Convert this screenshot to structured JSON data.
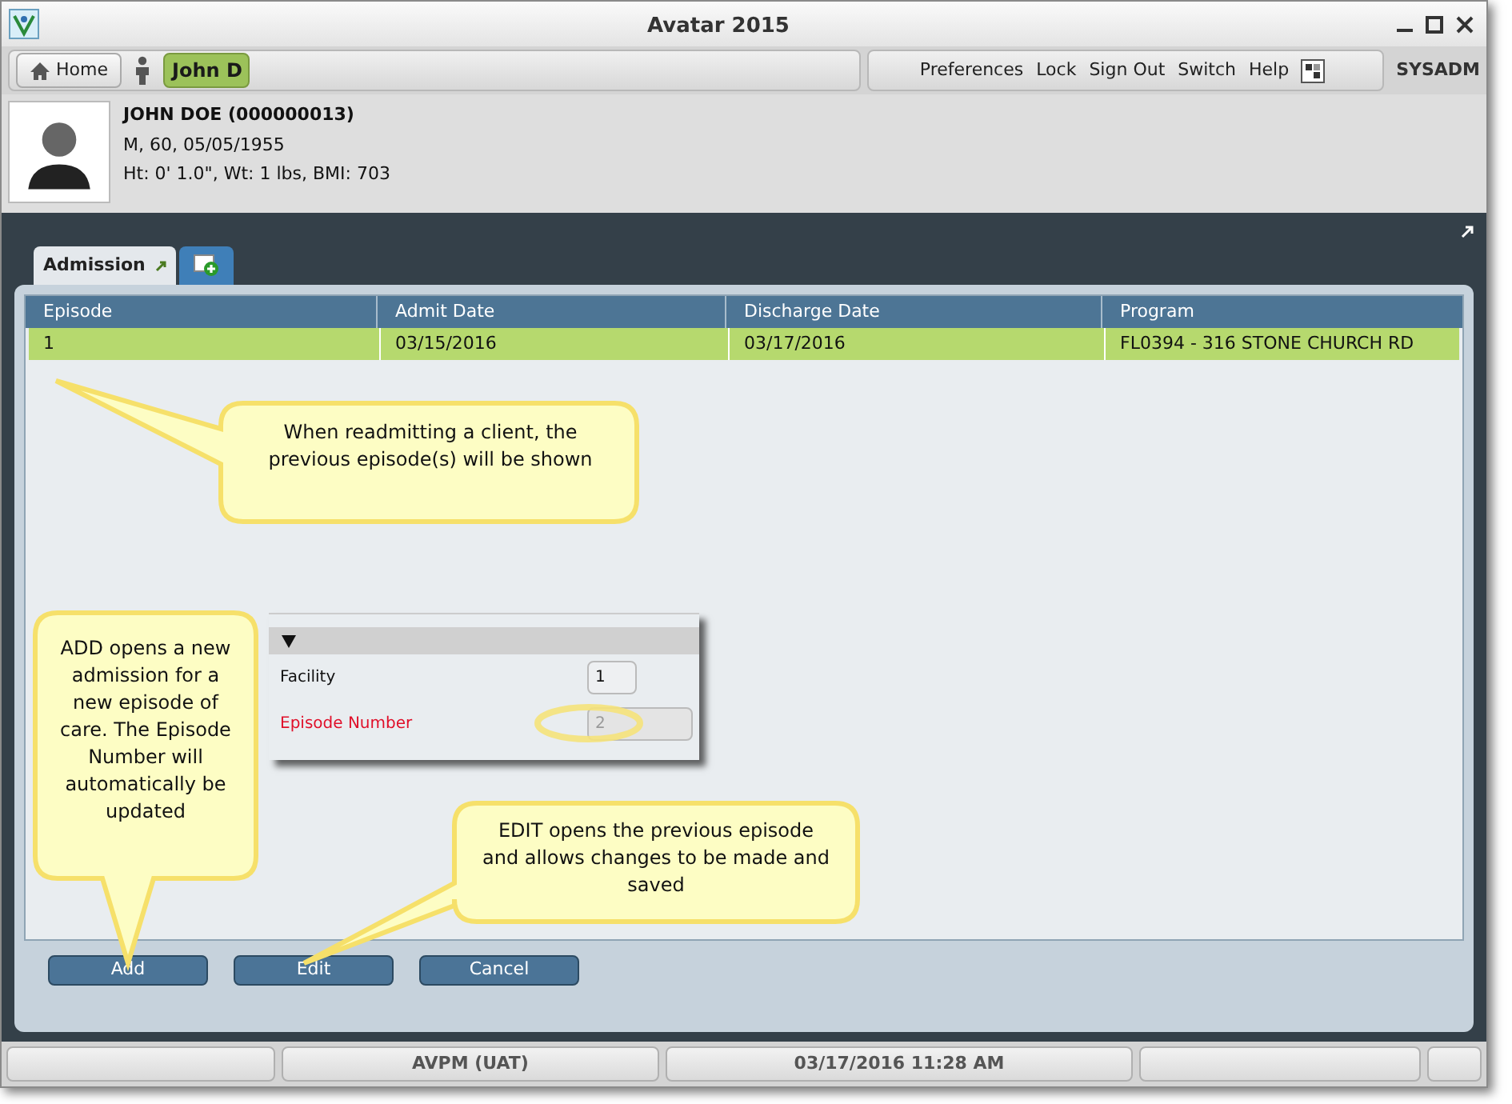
{
  "window": {
    "title": "Avatar 2015"
  },
  "toolbar": {
    "home": "Home",
    "client_tab": "John D",
    "menu": [
      "Preferences",
      "Lock",
      "Sign Out",
      "Switch",
      "Help"
    ],
    "user": "SYSADM"
  },
  "patient": {
    "name": "JOHN DOE (000000013)",
    "demographics": "M, 60, 05/05/1955",
    "vitals": "Ht: 0' 1.0\", Wt: 1 lbs, BMI: 703"
  },
  "tabs": [
    {
      "label": "Admission",
      "selected": true
    }
  ],
  "table": {
    "columns": [
      "Episode",
      "Admit Date",
      "Discharge Date",
      "Program"
    ],
    "rows": [
      {
        "cells": [
          "1",
          "03/15/2016",
          "03/17/2016",
          "FL0394 - 316 STONE CHURCH RD"
        ],
        "selected": true
      }
    ]
  },
  "inset": {
    "fields": [
      {
        "label": "Facility",
        "value": "1",
        "required": false,
        "disabled": false
      },
      {
        "label": "Episode Number",
        "value": "2",
        "required": true,
        "disabled": true
      }
    ]
  },
  "callouts": [
    "When readmitting a client, the previous episode(s) will be shown",
    "ADD opens a new admission for a new episode of care. The Episode Number will automatically be updated",
    "EDIT opens the previous episode and allows changes to be made and saved"
  ],
  "buttons": [
    "Add",
    "Edit",
    "Cancel"
  ],
  "status_bar": [
    "AVPM (UAT)",
    "03/17/2016 11:28 AM"
  ]
}
